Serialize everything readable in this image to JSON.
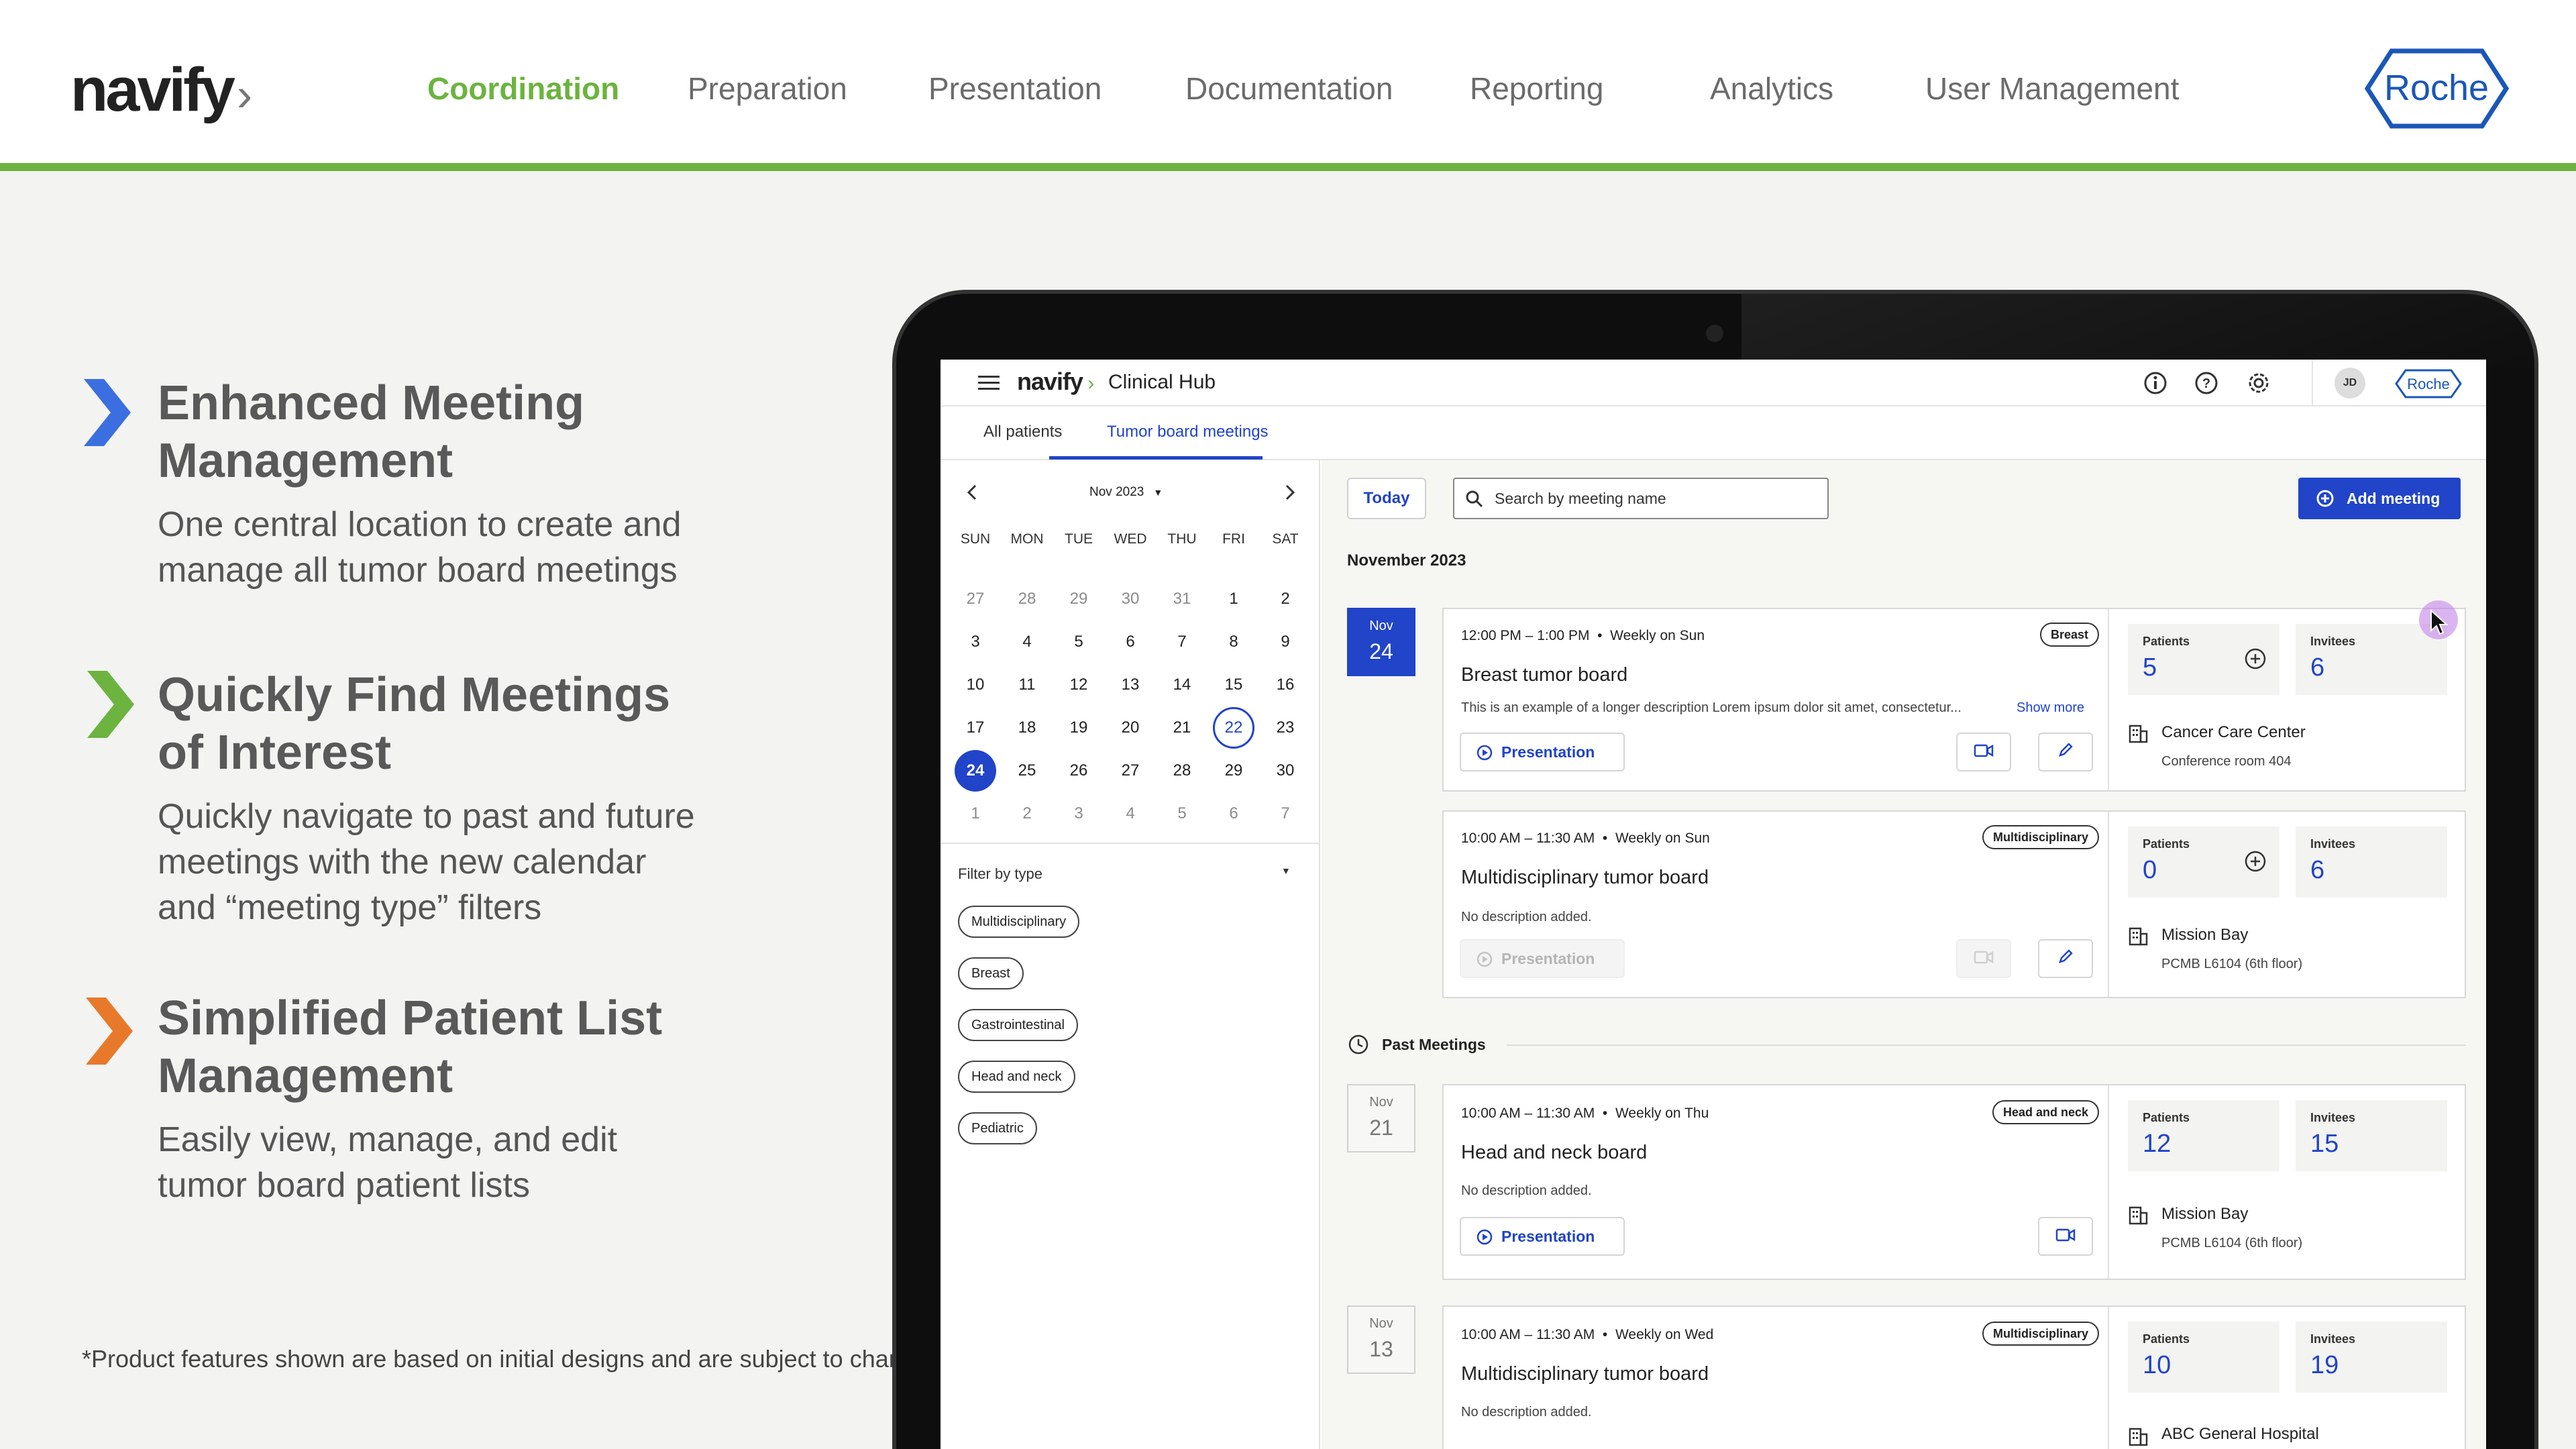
{
  "brand": {
    "logo_text": "navify",
    "client_logo": "Roche",
    "accent": "#6cb33f",
    "primary": "#2144c8"
  },
  "nav": {
    "items": [
      "Coordination",
      "Preparation",
      "Presentation",
      "Documentation",
      "Reporting",
      "Analytics",
      "User Management"
    ],
    "active": "Coordination"
  },
  "features": [
    {
      "title_l1": "Enhanced Meeting",
      "title_l2": "Management",
      "desc_l1": "One central location to create and",
      "desc_l2": "manage all tumor board meetings",
      "desc_l3": "",
      "chevron_color": "#3b6fe0"
    },
    {
      "title_l1": "Quickly Find Meetings",
      "title_l2": "of Interest",
      "desc_l1": "Quickly navigate to past and future",
      "desc_l2": "meetings with the new calendar",
      "desc_l3": "and “meeting type” filters",
      "chevron_color": "#6cb33f"
    },
    {
      "title_l1": "Simplified Patient List",
      "title_l2": "Management",
      "desc_l1": "Easily view, manage, and edit",
      "desc_l2": "tumor board patient lists",
      "desc_l3": "",
      "chevron_color": "#e8792b"
    }
  ],
  "footnote": "*Product features shown are based on initial designs and are subject to change.",
  "app": {
    "logo": "navify",
    "name": "Clinical Hub",
    "user_initials": "JD",
    "tabs": [
      "All patients",
      "Tumor board meetings"
    ],
    "calendar": {
      "month_label": "Nov 2023",
      "dow": [
        "SUN",
        "MON",
        "TUE",
        "WED",
        "THU",
        "FRI",
        "SAT"
      ],
      "weeks": [
        [
          "27",
          "28",
          "29",
          "30",
          "31",
          "1",
          "2"
        ],
        [
          "3",
          "4",
          "5",
          "6",
          "7",
          "8",
          "9"
        ],
        [
          "10",
          "11",
          "12",
          "13",
          "14",
          "15",
          "16"
        ],
        [
          "17",
          "18",
          "19",
          "20",
          "21",
          "22",
          "23"
        ],
        [
          "24",
          "25",
          "26",
          "27",
          "28",
          "29",
          "30"
        ],
        [
          "1",
          "2",
          "3",
          "4",
          "5",
          "6",
          "7"
        ]
      ],
      "today": "22",
      "selected": "24"
    },
    "filter": {
      "label": "Filter by type",
      "chips": [
        "Multidisciplinary",
        "Breast",
        "Gastrointestinal",
        "Head and neck",
        "Pediatric"
      ]
    },
    "toolbar": {
      "today_label": "Today",
      "search_placeholder": "Search by meeting name",
      "add_label": "Add meeting"
    },
    "month_heading": "November 2023",
    "past_heading": "Past Meetings",
    "labels": {
      "patients": "Patients",
      "invitees": "Invitees",
      "presentation": "Presentation",
      "show_more": "Show more"
    },
    "meetings": [
      {
        "month": "Nov",
        "day": "24",
        "time": "12:00 PM – 1:00 PM",
        "recurrence": "Weekly on Sun",
        "badge": "Breast",
        "title": "Breast tumor board",
        "desc": "This is an example of a longer description Lorem ipsum dolor sit amet, consectetur...",
        "patients": "5",
        "invitees": "6",
        "location": "Cancer Care Center",
        "room": "Conference room 404"
      },
      {
        "month": "",
        "day": "",
        "time": "10:00 AM – 11:30 AM",
        "recurrence": "Weekly on Sun",
        "badge": "Multidisciplinary",
        "title": "Multidisciplinary tumor board",
        "desc": "No description added.",
        "patients": "0",
        "invitees": "6",
        "location": "Mission Bay",
        "room": "PCMB L6104 (6th floor)"
      },
      {
        "month": "Nov",
        "day": "21",
        "time": "10:00 AM – 11:30 AM",
        "recurrence": "Weekly on Thu",
        "badge": "Head and neck",
        "title": "Head and neck board",
        "desc": "No description added.",
        "patients": "12",
        "invitees": "15",
        "location": "Mission Bay",
        "room": "PCMB L6104 (6th floor)"
      },
      {
        "month": "Nov",
        "day": "13",
        "time": "10:00 AM – 11:30 AM",
        "recurrence": "Weekly on Wed",
        "badge": "Multidisciplinary",
        "title": "Multidisciplinary tumor board",
        "desc": "No description added.",
        "patients": "10",
        "invitees": "19",
        "location": "ABC General Hospital",
        "room": ""
      }
    ]
  }
}
